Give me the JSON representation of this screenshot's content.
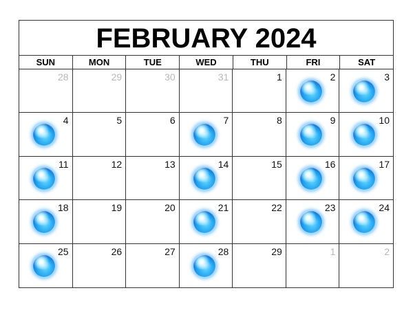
{
  "calendar": {
    "title": "FEBRUARY 2024",
    "weekdays": [
      "SUN",
      "MON",
      "TUE",
      "WED",
      "THU",
      "FRI",
      "SAT"
    ],
    "days": [
      {
        "n": "28",
        "muted": true,
        "orb": false
      },
      {
        "n": "29",
        "muted": true,
        "orb": false
      },
      {
        "n": "30",
        "muted": true,
        "orb": false
      },
      {
        "n": "31",
        "muted": true,
        "orb": false
      },
      {
        "n": "1",
        "muted": false,
        "orb": false
      },
      {
        "n": "2",
        "muted": false,
        "orb": true
      },
      {
        "n": "3",
        "muted": false,
        "orb": true
      },
      {
        "n": "4",
        "muted": false,
        "orb": true
      },
      {
        "n": "5",
        "muted": false,
        "orb": false
      },
      {
        "n": "6",
        "muted": false,
        "orb": false
      },
      {
        "n": "7",
        "muted": false,
        "orb": true
      },
      {
        "n": "8",
        "muted": false,
        "orb": false
      },
      {
        "n": "9",
        "muted": false,
        "orb": true
      },
      {
        "n": "10",
        "muted": false,
        "orb": true
      },
      {
        "n": "11",
        "muted": false,
        "orb": true
      },
      {
        "n": "12",
        "muted": false,
        "orb": false
      },
      {
        "n": "13",
        "muted": false,
        "orb": false
      },
      {
        "n": "14",
        "muted": false,
        "orb": true
      },
      {
        "n": "15",
        "muted": false,
        "orb": false
      },
      {
        "n": "16",
        "muted": false,
        "orb": true
      },
      {
        "n": "17",
        "muted": false,
        "orb": true
      },
      {
        "n": "18",
        "muted": false,
        "orb": true
      },
      {
        "n": "19",
        "muted": false,
        "orb": false
      },
      {
        "n": "20",
        "muted": false,
        "orb": false
      },
      {
        "n": "21",
        "muted": false,
        "orb": true
      },
      {
        "n": "22",
        "muted": false,
        "orb": false
      },
      {
        "n": "23",
        "muted": false,
        "orb": true
      },
      {
        "n": "24",
        "muted": false,
        "orb": true
      },
      {
        "n": "25",
        "muted": false,
        "orb": true
      },
      {
        "n": "26",
        "muted": false,
        "orb": false
      },
      {
        "n": "27",
        "muted": false,
        "orb": false
      },
      {
        "n": "28",
        "muted": false,
        "orb": true
      },
      {
        "n": "29",
        "muted": false,
        "orb": false
      },
      {
        "n": "1",
        "muted": true,
        "orb": false
      },
      {
        "n": "2",
        "muted": true,
        "orb": false
      }
    ]
  },
  "colors": {
    "grid_line": "#333333",
    "muted_text": "#b8b8b8",
    "orb_blue": "#1fa3f0"
  },
  "icons": {
    "day_marker": "blue-orb-icon"
  }
}
